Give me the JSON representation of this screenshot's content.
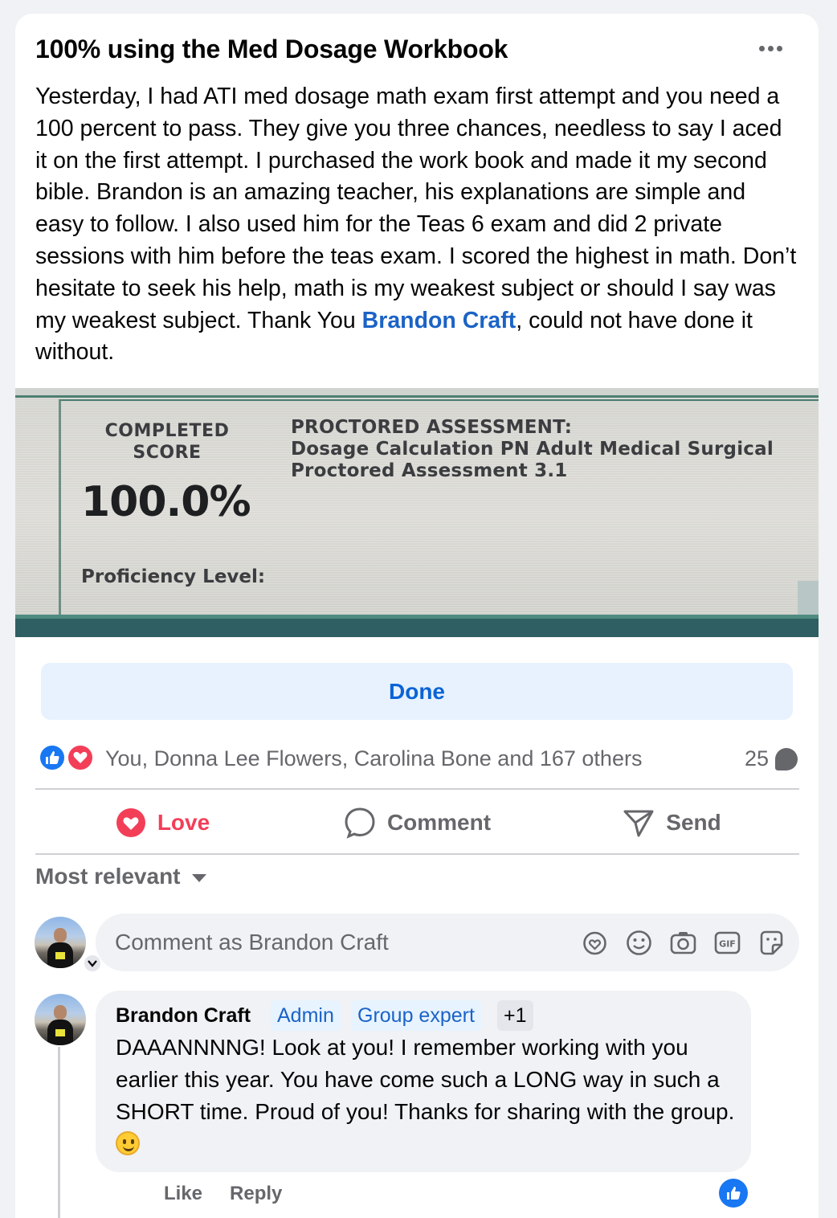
{
  "post": {
    "title": "100% using the Med Dosage Workbook",
    "body_text": "Yesterday, I had ATI med dosage math exam first attempt and you need a 100 percent to pass. They give you three chances, needless to say I aced it on the first attempt. I purchased the work book and made it my second bible. Brandon is an amazing teacher, his explanations are simple and easy to follow. I also used him for the Teas 6 exam and did 2 private sessions with him before the teas exam. I scored the highest in math. Don’t hesitate to seek his help, math is my weakest subject or should I say was my weakest subject. Thank You ",
    "mention": "Brandon Craft",
    "body_end": ", could not have done it without."
  },
  "photo": {
    "completed_label": "COMPLETED\nSCORE",
    "score": "100.0%",
    "assessment_label": "PROCTORED ASSESSMENT:",
    "assessment_name": "Dosage Calculation PN Adult Medical Surgical",
    "assessment_version": "Proctored Assessment 3.1",
    "proficiency_label": "Proficiency Level:"
  },
  "done_button": "Done",
  "reactions": {
    "summary": "You, Donna Lee Flowers, Carolina Bone and 167 others",
    "comment_count": "25"
  },
  "actions": {
    "love": "Love",
    "comment": "Comment",
    "send": "Send"
  },
  "sort": {
    "label": "Most relevant"
  },
  "composer": {
    "placeholder": "Comment as Brandon Craft"
  },
  "comment": {
    "author": "Brandon Craft",
    "badges": [
      "Admin",
      "Group expert",
      "+1"
    ],
    "text": "DAAANNNNG! Look at you! I remember working with you earlier this year. You have come such a LONG way in such a SHORT time. Proud of you! Thanks for sharing with the group. ",
    "like_label": "Like",
    "reply_label": "Reply"
  },
  "colors": {
    "accent_blue": "#1877f2",
    "love_red": "#f33e58",
    "mention_blue": "#1b63c6"
  },
  "icons": [
    "more-icon",
    "like-reaction-icon",
    "love-reaction-icon",
    "comment-bubble-icon",
    "love-icon",
    "comment-icon",
    "send-icon",
    "dropdown-arrow-icon",
    "avatar",
    "chevron-down-icon",
    "avatar-sticker-icon",
    "emoji-icon",
    "camera-icon",
    "gif-icon",
    "sticker-icon",
    "smiley-emoji-icon"
  ]
}
